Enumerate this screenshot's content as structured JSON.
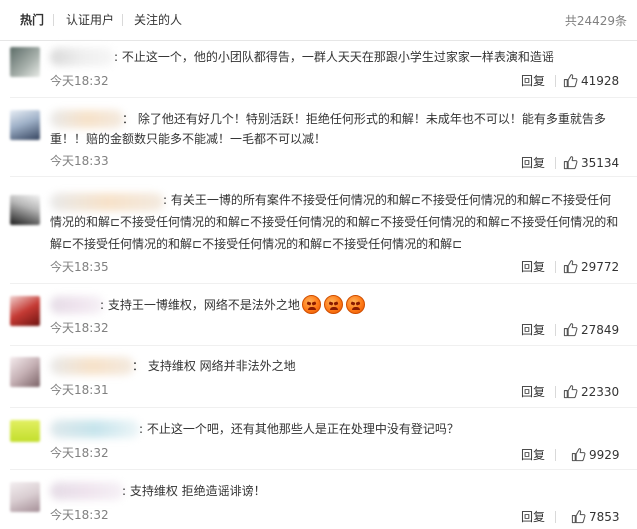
{
  "tabs": [
    {
      "label": "热门",
      "active": true
    },
    {
      "label": "认证用户",
      "active": false
    },
    {
      "label": "关注的人",
      "active": false
    }
  ],
  "total_label": "共24429条",
  "reply_label": "回复",
  "comments": [
    {
      "text_lines": [
        ":  不止这一个，他的小团队都得告，一群人天天在那跟小学生过家家一样表演和造谣"
      ],
      "time": "今天18:32",
      "likes": "41928"
    },
    {
      "text_lines": [
        "：  除了他还有好几个！特别活跃！拒绝任何形式的和解！未成年也不可以！能有多重就告多",
        "重！！赔的金额数只能多不能减！一毛都不可以减！"
      ],
      "time": "今天18:33",
      "likes": "35134"
    },
    {
      "text_lines": [
        ":  有关王一博的所有案件不接受任何情况的和解⊏不接受任何情况的和解⊏不接受任何",
        "情况的和解⊏不接受任何情况的和解⊏不接受任何情况的和解⊏不接受任何情况的和解⊏不接受任何情况的和",
        "解⊏不接受任何情况的和解⊏不接受任何情况的和解⊏不接受任何情况的和解⊏"
      ],
      "time": "今天18:35",
      "likes": "29772"
    },
    {
      "text_lines": [
        ":  支持王一博维权，网络不是法外之地"
      ],
      "emoji_count": 3,
      "time": "今天18:32",
      "likes": "27849"
    },
    {
      "text_lines": [
        "：  支持维权 网络并非法外之地"
      ],
      "time": "今天18:31",
      "likes": "22330"
    },
    {
      "text_lines": [
        ":  不止这一个吧，还有其他那些人是正在处理中没有登记吗？"
      ],
      "time": "今天18:32",
      "likes": "9929"
    },
    {
      "text_lines": [
        ":  支持维权 拒绝造谣诽谤！"
      ],
      "time": "今天18:32",
      "likes": "7853"
    }
  ]
}
